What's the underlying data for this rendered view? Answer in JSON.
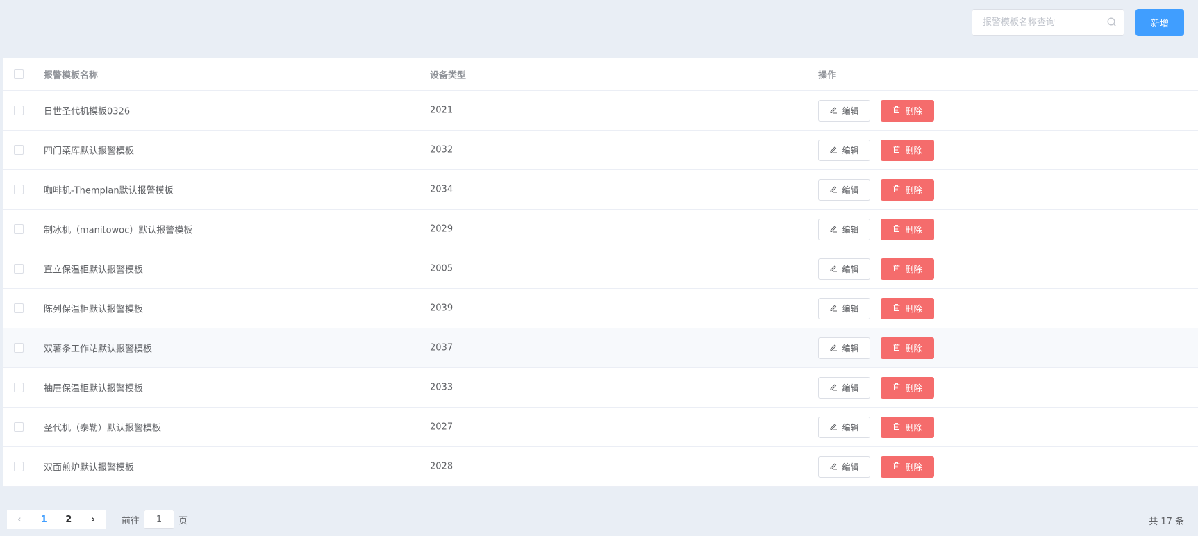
{
  "toolbar": {
    "search_placeholder": "报警模板名称查询",
    "add_label": "新增"
  },
  "table": {
    "headers": [
      "报警模板名称",
      "设备类型",
      "操作"
    ],
    "edit_label": "编辑",
    "delete_label": "删除",
    "rows": [
      {
        "name": "日世圣代机模板0326",
        "type": "2021"
      },
      {
        "name": "四门菜库默认报警模板",
        "type": "2032"
      },
      {
        "name": "咖啡机-Themplan默认报警模板",
        "type": "2034"
      },
      {
        "name": "制冰机（manitowoc）默认报警模板",
        "type": "2029"
      },
      {
        "name": "直立保温柜默认报警模板",
        "type": "2005"
      },
      {
        "name": "陈列保温柜默认报警模板",
        "type": "2039"
      },
      {
        "name": "双薯条工作站默认报警模板",
        "type": "2037"
      },
      {
        "name": "抽屉保温柜默认报警模板",
        "type": "2033"
      },
      {
        "name": "圣代机（泰勒）默认报警模板",
        "type": "2027"
      },
      {
        "name": "双面煎炉默认报警模板",
        "type": "2028"
      }
    ]
  },
  "pagination": {
    "pages": [
      "1",
      "2"
    ],
    "current": "1",
    "goto_prefix": "前往",
    "goto_value": "1",
    "goto_suffix": "页",
    "total": "共 17 条"
  },
  "colors": {
    "primary": "#409eff",
    "danger": "#f56c6c"
  }
}
